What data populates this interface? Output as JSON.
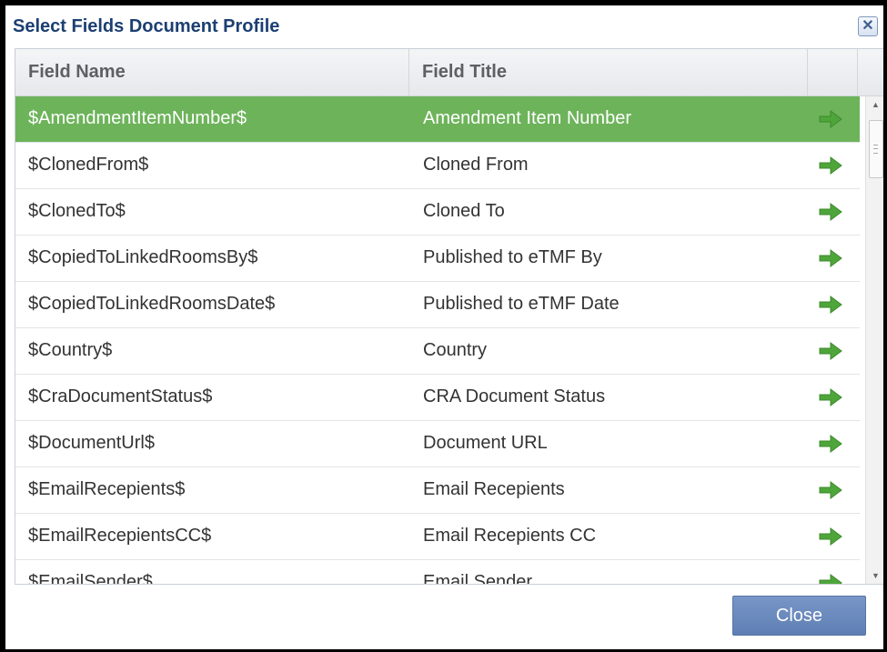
{
  "dialog": {
    "title": "Select Fields Document Profile",
    "close_icon_glyph": "✕"
  },
  "grid": {
    "columns": {
      "field_name": "Field Name",
      "field_title": "Field Title"
    },
    "selected_index": 0,
    "rows": [
      {
        "name": "$AmendmentItemNumber$",
        "title": "Amendment Item Number"
      },
      {
        "name": "$ClonedFrom$",
        "title": "Cloned From"
      },
      {
        "name": "$ClonedTo$",
        "title": "Cloned To"
      },
      {
        "name": "$CopiedToLinkedRoomsBy$",
        "title": "Published to eTMF By"
      },
      {
        "name": "$CopiedToLinkedRoomsDate$",
        "title": "Published to eTMF Date"
      },
      {
        "name": "$Country$",
        "title": "Country"
      },
      {
        "name": "$CraDocumentStatus$",
        "title": "CRA Document Status"
      },
      {
        "name": "$DocumentUrl$",
        "title": "Document URL"
      },
      {
        "name": "$EmailRecepients$",
        "title": "Email Recepients"
      },
      {
        "name": "$EmailRecepientsCC$",
        "title": "Email Recepients CC"
      },
      {
        "name": "$EmailSender$",
        "title": "Email Sender"
      }
    ],
    "action_icon": "arrow-right-icon"
  },
  "footer": {
    "close_label": "Close"
  },
  "colors": {
    "title": "#1b3f72",
    "selected_row": "#6db35a",
    "arrow": "#4ea63a",
    "close_button": "#6a89bd"
  }
}
